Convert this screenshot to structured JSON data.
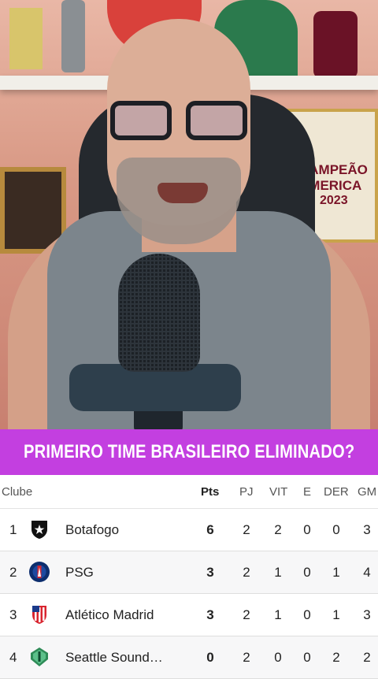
{
  "video": {
    "pennant_lines": [
      "CAMPEÃO",
      "AMERICA",
      "2023"
    ]
  },
  "banner": {
    "title": "PRIMEIRO TIME BRASILEIRO ELIMINADO?"
  },
  "table": {
    "headers": {
      "club": "Clube",
      "pts": "Pts",
      "pj": "PJ",
      "vit": "VIT",
      "e": "E",
      "der": "DER",
      "gm": "GM"
    },
    "rows": [
      {
        "pos": "1",
        "club": "Botafogo",
        "pts": "6",
        "pj": "2",
        "vit": "2",
        "e": "0",
        "der": "0",
        "gm": "3",
        "logo": "botafogo-star-crest"
      },
      {
        "pos": "2",
        "club": "PSG",
        "pts": "3",
        "pj": "2",
        "vit": "1",
        "e": "0",
        "der": "1",
        "gm": "4",
        "logo": "psg-crest"
      },
      {
        "pos": "3",
        "club": "Atlético Madrid",
        "pts": "3",
        "pj": "2",
        "vit": "1",
        "e": "0",
        "der": "1",
        "gm": "3",
        "logo": "atletico-madrid-crest"
      },
      {
        "pos": "4",
        "club": "Seattle Sound…",
        "pts": "0",
        "pj": "2",
        "vit": "0",
        "e": "0",
        "der": "2",
        "gm": "2",
        "logo": "seattle-sounders-crest"
      }
    ]
  },
  "colors": {
    "banner": "#c33fe0",
    "banner_text": "#ffffff"
  }
}
